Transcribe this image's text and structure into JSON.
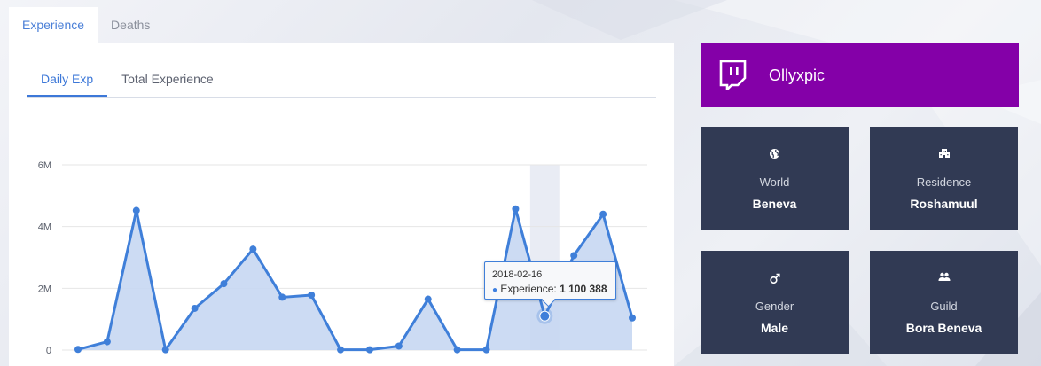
{
  "tabs_top": [
    {
      "label": "Experience",
      "active": true
    },
    {
      "label": "Deaths",
      "active": false
    }
  ],
  "subtabs": [
    {
      "label": "Daily Exp",
      "active": true
    },
    {
      "label": "Total Experience",
      "active": false
    }
  ],
  "chart_data": {
    "type": "area",
    "series": [
      {
        "values": [
          20000,
          270000,
          4520000,
          10000,
          1350000,
          2150000,
          3270000,
          1710000,
          1780000,
          10000,
          10000,
          130000,
          1650000,
          10000,
          10000,
          4570000,
          1100388,
          3060000,
          4400000,
          1040000
        ]
      }
    ],
    "ylim": [
      0,
      6000000
    ],
    "yticks": [
      "0",
      "2M",
      "4M",
      "6M"
    ],
    "ytick_values": [
      0,
      2000000,
      4000000,
      6000000
    ],
    "highlight_index": 16,
    "grid": true,
    "colors": {
      "line": "#3f7fd9",
      "fill": "#c6d7f2",
      "highlight_band": "#e9ecf4"
    }
  },
  "tooltip": {
    "date": "2018-02-16",
    "series_label": "Experience:",
    "value": "1 100 388"
  },
  "twitch": {
    "name": "Ollyxpic",
    "icon": "twitch-icon",
    "color": "#8400a8"
  },
  "cards": [
    {
      "icon": "globe-icon",
      "label": "World",
      "value": "Beneva"
    },
    {
      "icon": "building-icon",
      "label": "Residence",
      "value": "Roshamuul"
    },
    {
      "icon": "gender-icon",
      "label": "Gender",
      "value": "Male"
    },
    {
      "icon": "group-icon",
      "label": "Guild",
      "value": "Bora Beneva"
    }
  ],
  "colors": {
    "accent": "#3d78d8",
    "card_bg": "#313a54"
  }
}
